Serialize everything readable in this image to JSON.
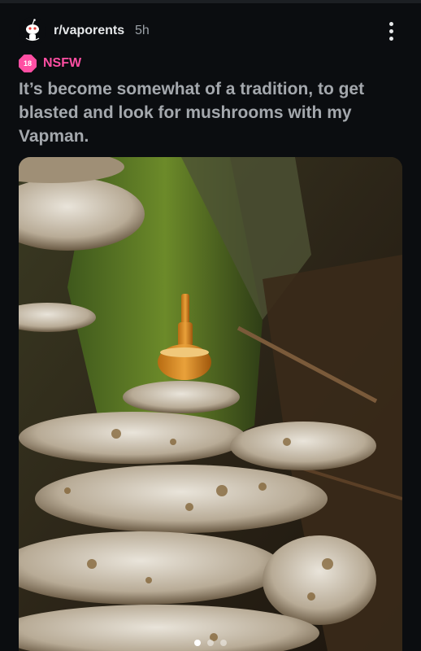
{
  "post": {
    "subreddit": "r/vaporents",
    "age": "5h",
    "nsfw_badge": "18",
    "nsfw_label": "NSFW",
    "title": "It’s become somewhat of a tradition, to get blasted and look for mushrooms with my Vapman."
  },
  "gallery": {
    "image": "photo of shelf mushrooms with a wooden Vapman vaporizer on a mossy tree trunk",
    "page_count": 3,
    "current_page": 1
  },
  "colors": {
    "background": "#0b0d10",
    "nsfw": "#ff4fa3",
    "title": "#a4a8ad"
  }
}
